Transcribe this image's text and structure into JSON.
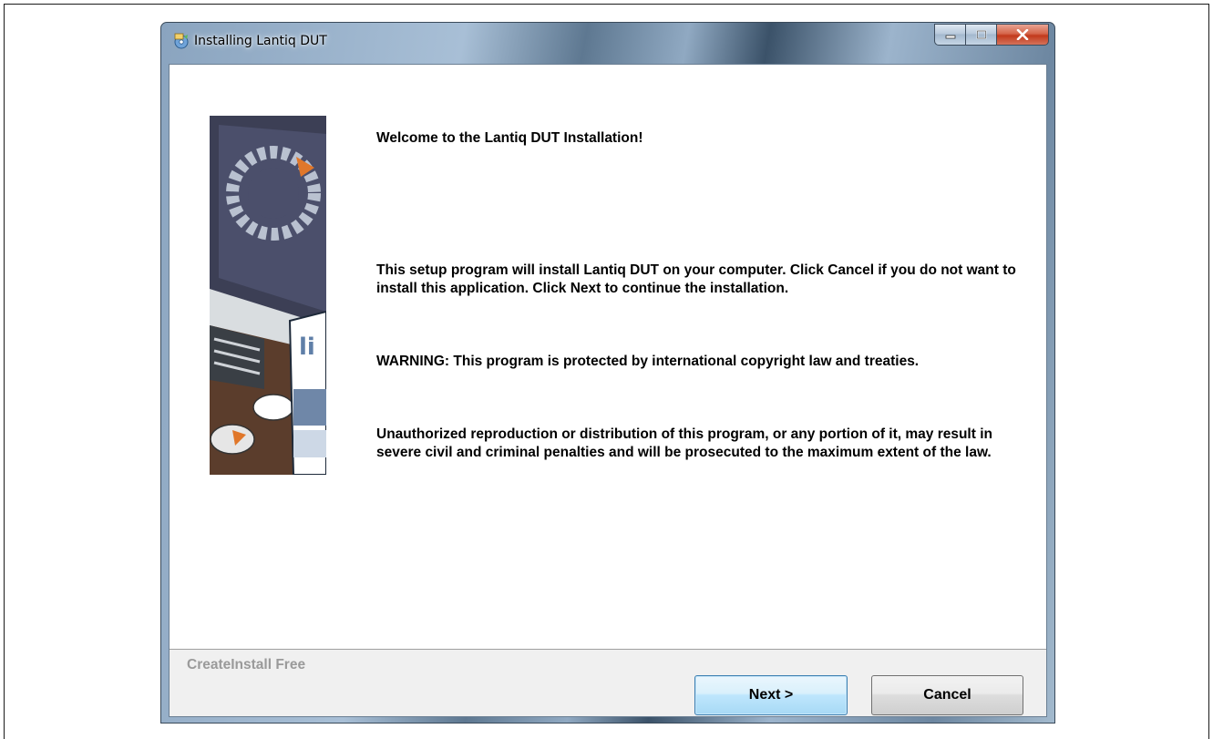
{
  "window": {
    "title": "Installing Lantiq DUT",
    "icon": "installer-icon"
  },
  "caption": {
    "minimize_icon": "minimize-icon",
    "maximize_icon": "maximize-icon",
    "close_icon": "close-icon"
  },
  "content": {
    "welcome": "Welcome to the Lantiq DUT Installation!",
    "paragraph1": "This setup program will install Lantiq DUT on your computer. Click Cancel if you do not want to install this application. Click Next to continue the installation.",
    "paragraph2": "WARNING: This program is protected by international copyright law and treaties.",
    "paragraph3": "Unauthorized reproduction or distribution of this program, or any portion of it, may result in severe civil and criminal penalties and will be prosecuted to the maximum extent of the law."
  },
  "footer": {
    "brand": "CreateInstall Free",
    "next_label": "Next >",
    "cancel_label": "Cancel"
  },
  "colors": {
    "next_button_border": "#3c7fb1",
    "brand_text": "#9a9a9a"
  }
}
